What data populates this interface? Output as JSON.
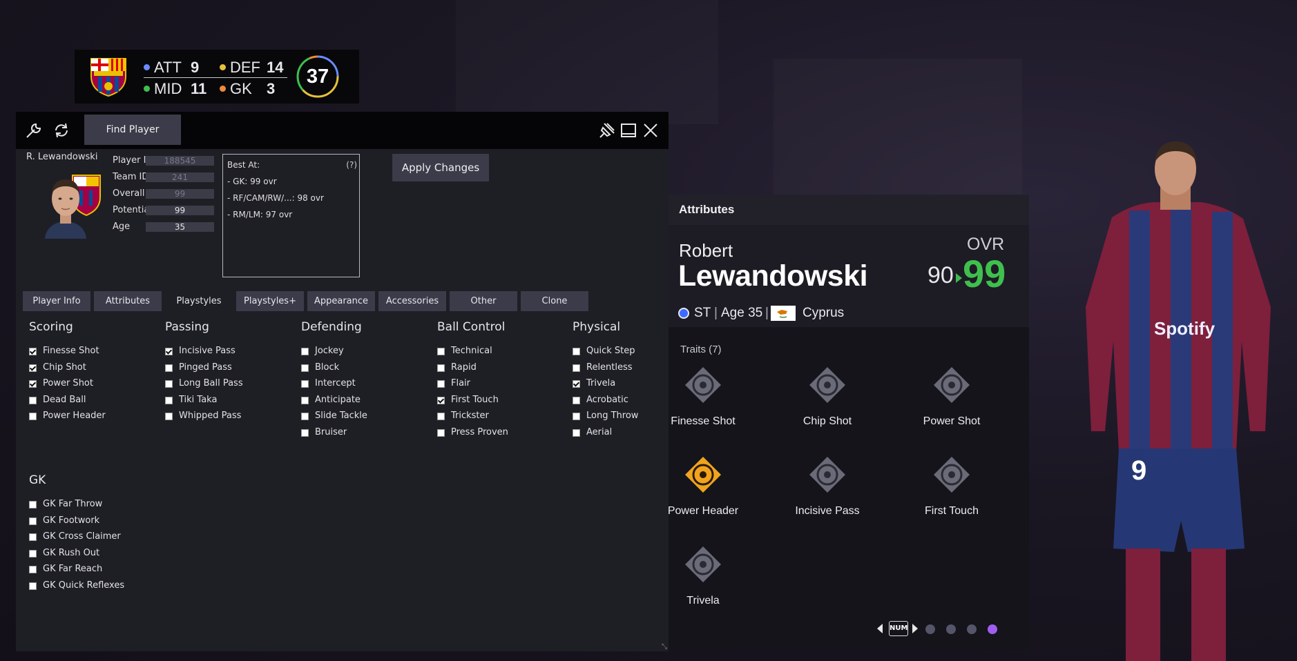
{
  "squad": {
    "counts": [
      {
        "label": "ATT",
        "value": "9",
        "color": "#6b8cff"
      },
      {
        "label": "DEF",
        "value": "14",
        "color": "#e6c13b"
      },
      {
        "label": "MID",
        "value": "11",
        "color": "#3fc04e"
      },
      {
        "label": "GK",
        "value": "3",
        "color": "#f08a3a"
      }
    ],
    "total": "37"
  },
  "toolbar": {
    "find_label": "Find Player"
  },
  "player": {
    "short_name": "R. Lewandowski",
    "fields": [
      {
        "label": "Player ID",
        "value": "188545"
      },
      {
        "label": "Team ID",
        "value": "241"
      },
      {
        "label": "Overall",
        "value": "99"
      },
      {
        "label": "Potential",
        "value": "99"
      },
      {
        "label": "Age",
        "value": "35"
      }
    ]
  },
  "best_at": {
    "title": "Best At:",
    "help": "(?)",
    "lines": [
      "- GK: 99 ovr",
      "- RF/CAM/RW/...: 98 ovr",
      "- RM/LM: 97 ovr"
    ]
  },
  "apply_label": "Apply Changes",
  "tabs": [
    "Player Info",
    "Attributes",
    "Playstyles",
    "Playstyles+",
    "Appearance",
    "Accessories",
    "Other",
    "Clone"
  ],
  "playstyles": [
    {
      "category": "Scoring",
      "items": [
        {
          "label": "Finesse Shot",
          "checked": true
        },
        {
          "label": "Chip Shot",
          "checked": true
        },
        {
          "label": "Power Shot",
          "checked": true
        },
        {
          "label": "Dead Ball",
          "checked": false
        },
        {
          "label": "Power Header",
          "checked": false
        }
      ]
    },
    {
      "category": "Passing",
      "items": [
        {
          "label": "Incisive Pass",
          "checked": true
        },
        {
          "label": "Pinged Pass",
          "checked": false
        },
        {
          "label": "Long Ball Pass",
          "checked": false
        },
        {
          "label": "Tiki Taka",
          "checked": false
        },
        {
          "label": "Whipped Pass",
          "checked": false
        }
      ]
    },
    {
      "category": "Defending",
      "items": [
        {
          "label": "Jockey",
          "checked": false
        },
        {
          "label": "Block",
          "checked": false
        },
        {
          "label": "Intercept",
          "checked": false
        },
        {
          "label": "Anticipate",
          "checked": false
        },
        {
          "label": "Slide Tackle",
          "checked": false
        },
        {
          "label": "Bruiser",
          "checked": false
        }
      ]
    },
    {
      "category": "Ball Control",
      "items": [
        {
          "label": "Technical",
          "checked": false
        },
        {
          "label": "Rapid",
          "checked": false
        },
        {
          "label": "Flair",
          "checked": false
        },
        {
          "label": "First Touch",
          "checked": true
        },
        {
          "label": "Trickster",
          "checked": false
        },
        {
          "label": "Press Proven",
          "checked": false
        }
      ]
    },
    {
      "category": "Physical",
      "items": [
        {
          "label": "Quick Step",
          "checked": false
        },
        {
          "label": "Relentless",
          "checked": false
        },
        {
          "label": "Trivela",
          "checked": true
        },
        {
          "label": "Acrobatic",
          "checked": false
        },
        {
          "label": "Long Throw",
          "checked": false
        },
        {
          "label": "Aerial",
          "checked": false
        }
      ]
    },
    {
      "category": "GK",
      "items": [
        {
          "label": "GK Far Throw",
          "checked": false
        },
        {
          "label": "GK Footwork",
          "checked": false
        },
        {
          "label": "GK Cross Claimer",
          "checked": false
        },
        {
          "label": "GK Rush Out",
          "checked": false
        },
        {
          "label": "GK Far Reach",
          "checked": false
        },
        {
          "label": "GK Quick Reflexes",
          "checked": false
        }
      ]
    }
  ],
  "attributes_panel": {
    "header": "Attributes",
    "first_name": "Robert",
    "last_name": "Lewandowski",
    "ovr_label": "OVR",
    "ovr_old": "90",
    "ovr_new": "99",
    "position": "ST",
    "age": "Age 35",
    "nation": "Cyprus",
    "traits_title": "Traits (7)",
    "traits": [
      {
        "name": "Finesse Shot",
        "icon": "finesse-shot-icon",
        "plus": false
      },
      {
        "name": "Chip Shot",
        "icon": "chip-shot-icon",
        "plus": false
      },
      {
        "name": "Power Shot",
        "icon": "power-shot-icon",
        "plus": false
      },
      {
        "name": "Power Header",
        "icon": "power-header-icon",
        "plus": true
      },
      {
        "name": "Incisive Pass",
        "icon": "incisive-pass-icon",
        "plus": false
      },
      {
        "name": "First Touch",
        "icon": "first-touch-icon",
        "plus": false
      },
      {
        "name": "Trivela",
        "icon": "trivela-icon",
        "plus": false
      }
    ],
    "pager_key": "NUM",
    "pages": 4,
    "active_page": 4
  },
  "colors": {
    "accent_green": "#3fc04e",
    "plus_gold": "#f0a31e",
    "pager_active": "#a05ef0"
  }
}
